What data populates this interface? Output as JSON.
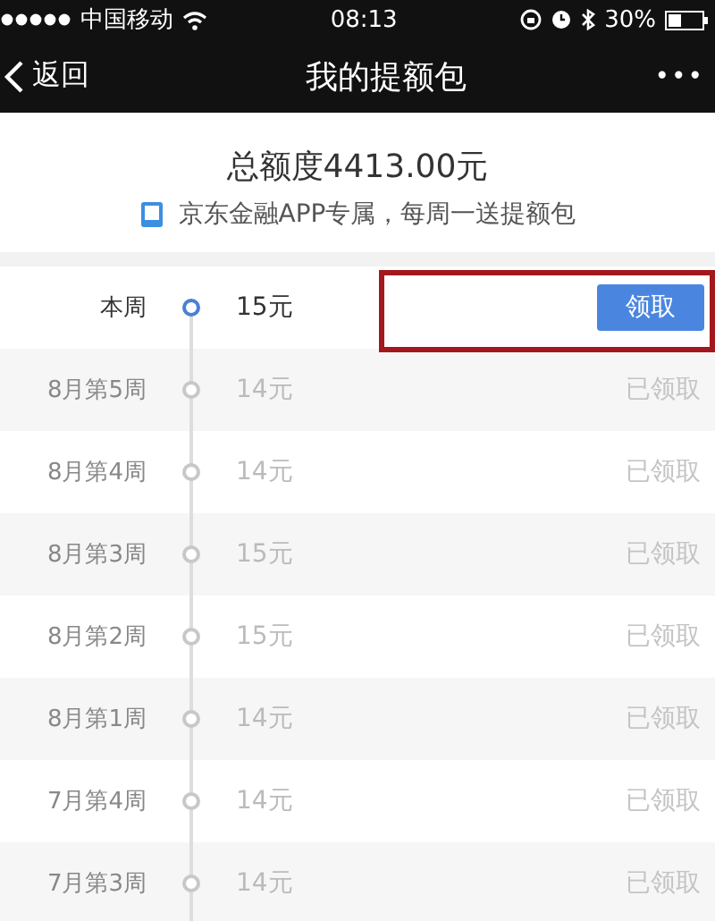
{
  "status_bar": {
    "carrier": "中国移动",
    "time": "08:13",
    "battery": "30%"
  },
  "nav": {
    "back": "返回",
    "title": "我的提额包",
    "more": "•••"
  },
  "summary": {
    "total": "总额度4413.00元",
    "note": "京东金融APP专属，每周一送提额包"
  },
  "weeks": [
    {
      "label": "本周",
      "amount": "15元",
      "kind": "current",
      "action": "领取",
      "annotated": true
    },
    {
      "label": "8月第5周",
      "amount": "14元",
      "kind": "claimed",
      "action": "已领取",
      "annotated": false
    },
    {
      "label": "8月第4周",
      "amount": "14元",
      "kind": "claimed",
      "action": "已领取",
      "annotated": false
    },
    {
      "label": "8月第3周",
      "amount": "15元",
      "kind": "claimed",
      "action": "已领取",
      "annotated": false
    },
    {
      "label": "8月第2周",
      "amount": "15元",
      "kind": "claimed",
      "action": "已领取",
      "annotated": false
    },
    {
      "label": "8月第1周",
      "amount": "14元",
      "kind": "claimed",
      "action": "已领取",
      "annotated": false
    },
    {
      "label": "7月第4周",
      "amount": "14元",
      "kind": "claimed",
      "action": "已领取",
      "annotated": false
    },
    {
      "label": "7月第3周",
      "amount": "14元",
      "kind": "claimed",
      "action": "已领取",
      "annotated": false
    }
  ]
}
